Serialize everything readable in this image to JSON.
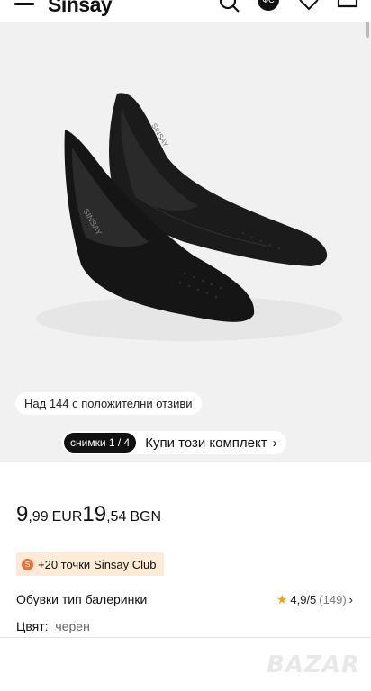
{
  "header": {
    "logo": "Sinsay",
    "avatar_label": "ФС",
    "icons": [
      "menu-icon",
      "search-icon",
      "heart-icon",
      "cart-icon"
    ]
  },
  "gallery": {
    "review_badge": "Над 144 с положителни отзиви",
    "photo_counter": "снимки 1 / 4",
    "buy_set_label": "Купи този комплект",
    "shoe_brand": "SINSAY"
  },
  "product": {
    "price_eur_int": "9",
    "price_eur_dec": ",99",
    "price_eur_currency": "EUR",
    "price_bgn_int": "19",
    "price_bgn_dec": ",54",
    "price_bgn_currency": "BGN",
    "points": "+20 точки",
    "club": "Sinsay Club",
    "name": "Обувки тип балеринки",
    "rating": "4,9/5",
    "rating_count": "(149)",
    "color_label": "Цвят:",
    "color_value": "черен"
  },
  "watermark": "BAZAR",
  "colors": {
    "accent_orange": "#e8723a",
    "badge_bg": "#fdebd8",
    "star": "#f0a500"
  }
}
